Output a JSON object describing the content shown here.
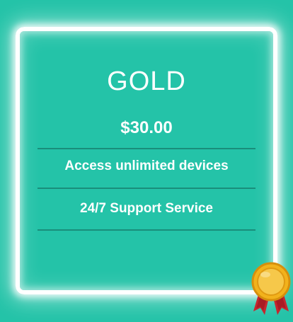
{
  "plan": {
    "name": "GOLD",
    "price": "$30.00",
    "features": [
      "Access unlimited devices",
      "24/7 Support Service"
    ]
  },
  "colors": {
    "background": "#24c3a8",
    "border_glow": "#ffffff",
    "divider": "#1a8e7b",
    "medal_gold": "#f2b21c",
    "ribbon_red": "#c6262e"
  },
  "icons": {
    "badge": "gold-medal-icon"
  }
}
